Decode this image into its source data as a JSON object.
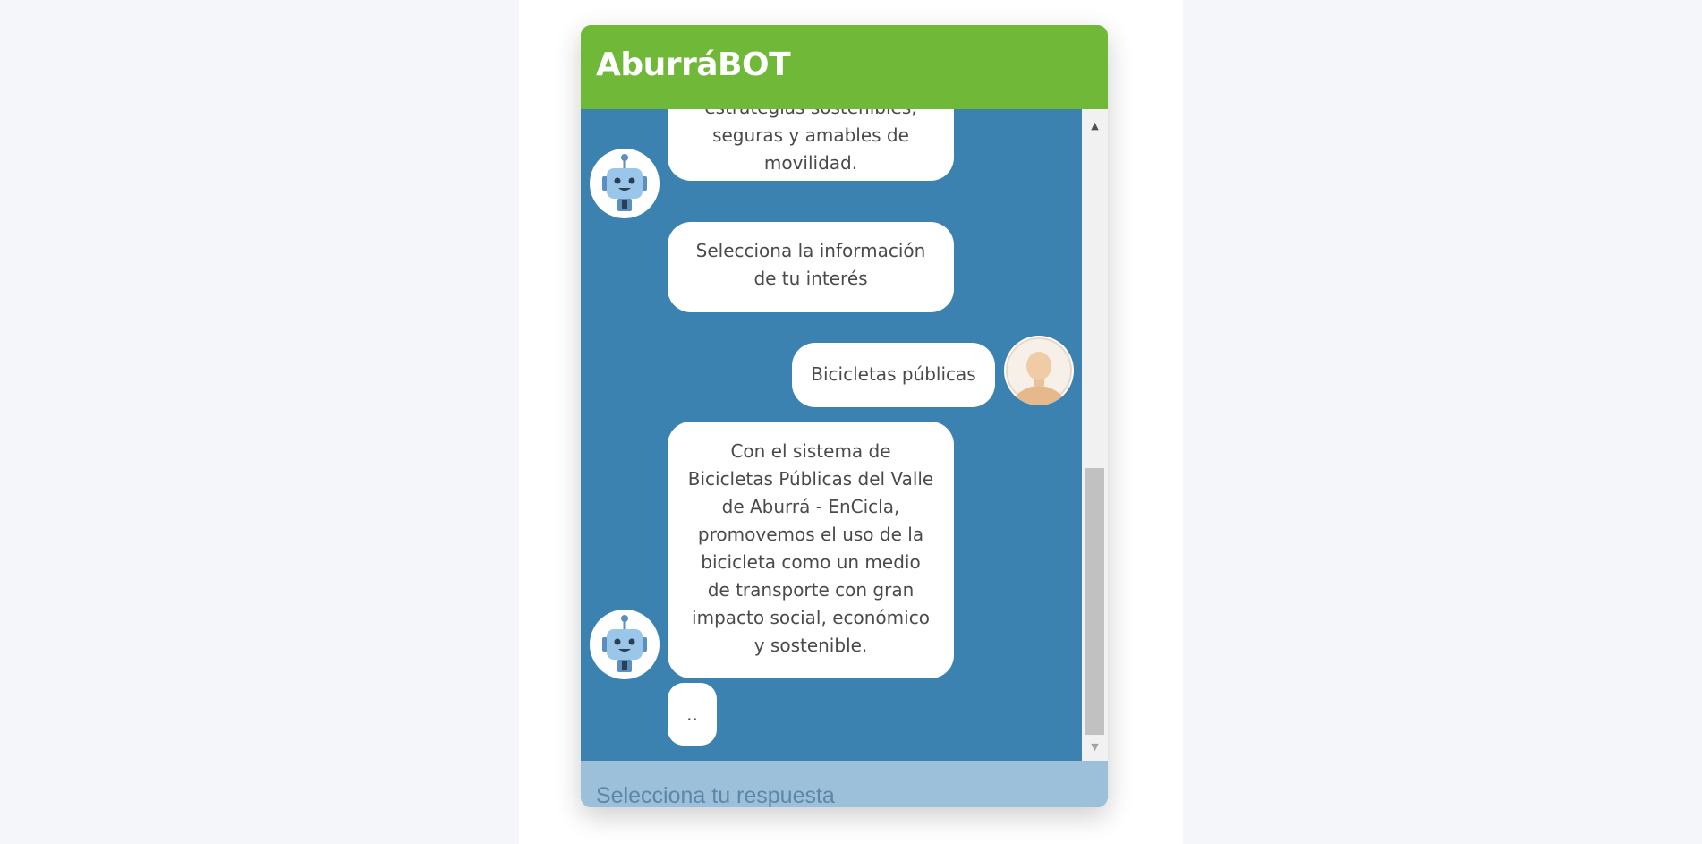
{
  "header": {
    "title": "AburráBOT"
  },
  "messages": [
    {
      "from": "bot",
      "text": "estrategias sostenibles,\nseguras y amables de\nmovilidad."
    },
    {
      "from": "bot",
      "text": "Selecciona la información\nde tu interés"
    },
    {
      "from": "user",
      "text": "Bicicletas públicas"
    },
    {
      "from": "bot",
      "text": "Con el sistema de\nBicicletas Públicas del Valle\nde Aburrá - EnCicla,\npromovemos el uso de la\nbicicleta como un medio\nde transporte con gran\nimpacto social, económico\ny sostenible."
    },
    {
      "from": "bot",
      "text": ".."
    }
  ],
  "input": {
    "placeholder": "Selecciona tu respuesta"
  },
  "icons": {
    "bot_avatar": "robot-icon",
    "user_avatar": "user-icon",
    "scroll_up": "scroll-up-arrow-icon",
    "scroll_down": "scroll-down-arrow-icon"
  },
  "colors": {
    "header": "#70b838",
    "chat_background": "#3b82b0",
    "input_bar": "#9dc0da",
    "bubble": "#ffffff"
  }
}
